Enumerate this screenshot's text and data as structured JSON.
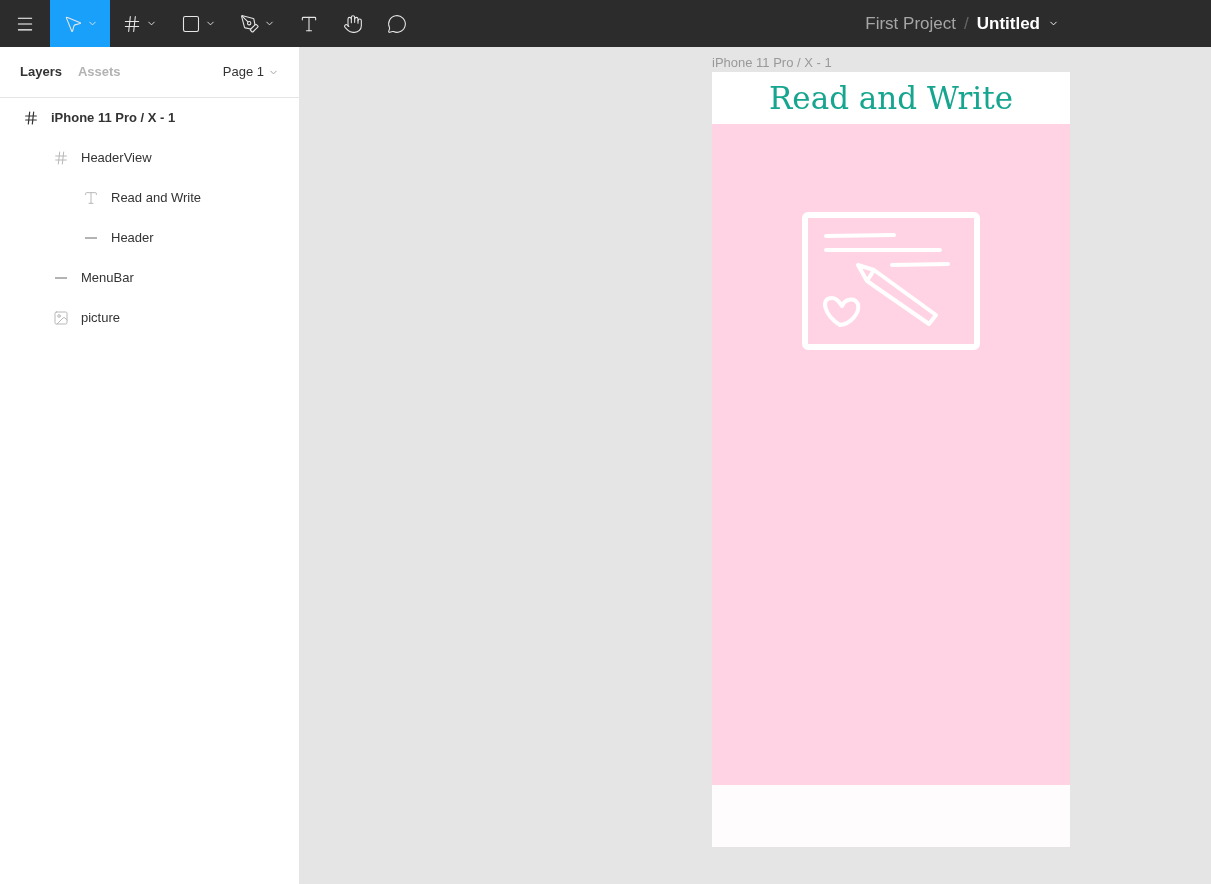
{
  "toolbar": {
    "tools": [
      {
        "kind": "move",
        "selected": true,
        "has_menu": true
      },
      {
        "kind": "frame",
        "selected": false,
        "has_menu": true
      },
      {
        "kind": "shape",
        "selected": false,
        "has_menu": true
      },
      {
        "kind": "pen",
        "selected": false,
        "has_menu": true
      },
      {
        "kind": "text",
        "selected": false,
        "has_menu": false
      },
      {
        "kind": "hand",
        "selected": false,
        "has_menu": false
      },
      {
        "kind": "comment",
        "selected": false,
        "has_menu": false
      }
    ],
    "project": "First Project",
    "separator": "/",
    "file": "Untitled"
  },
  "sidebar": {
    "tabs": [
      {
        "label": "Layers",
        "selected": true
      },
      {
        "label": "Assets",
        "selected": false
      }
    ],
    "page": "Page 1",
    "layers": [
      {
        "name": "iPhone 11 Pro / X - 1",
        "kind": "frame",
        "children": [
          {
            "name": "HeaderView",
            "kind": "frame",
            "children": [
              {
                "name": "Read and Write",
                "kind": "text"
              },
              {
                "name": "Header",
                "kind": "line"
              }
            ]
          },
          {
            "name": "MenuBar",
            "kind": "line"
          },
          {
            "name": "picture",
            "kind": "image"
          }
        ]
      }
    ]
  },
  "canvas": {
    "frame_label": "iPhone 11 Pro / X - 1",
    "heading": "Read and Write"
  }
}
